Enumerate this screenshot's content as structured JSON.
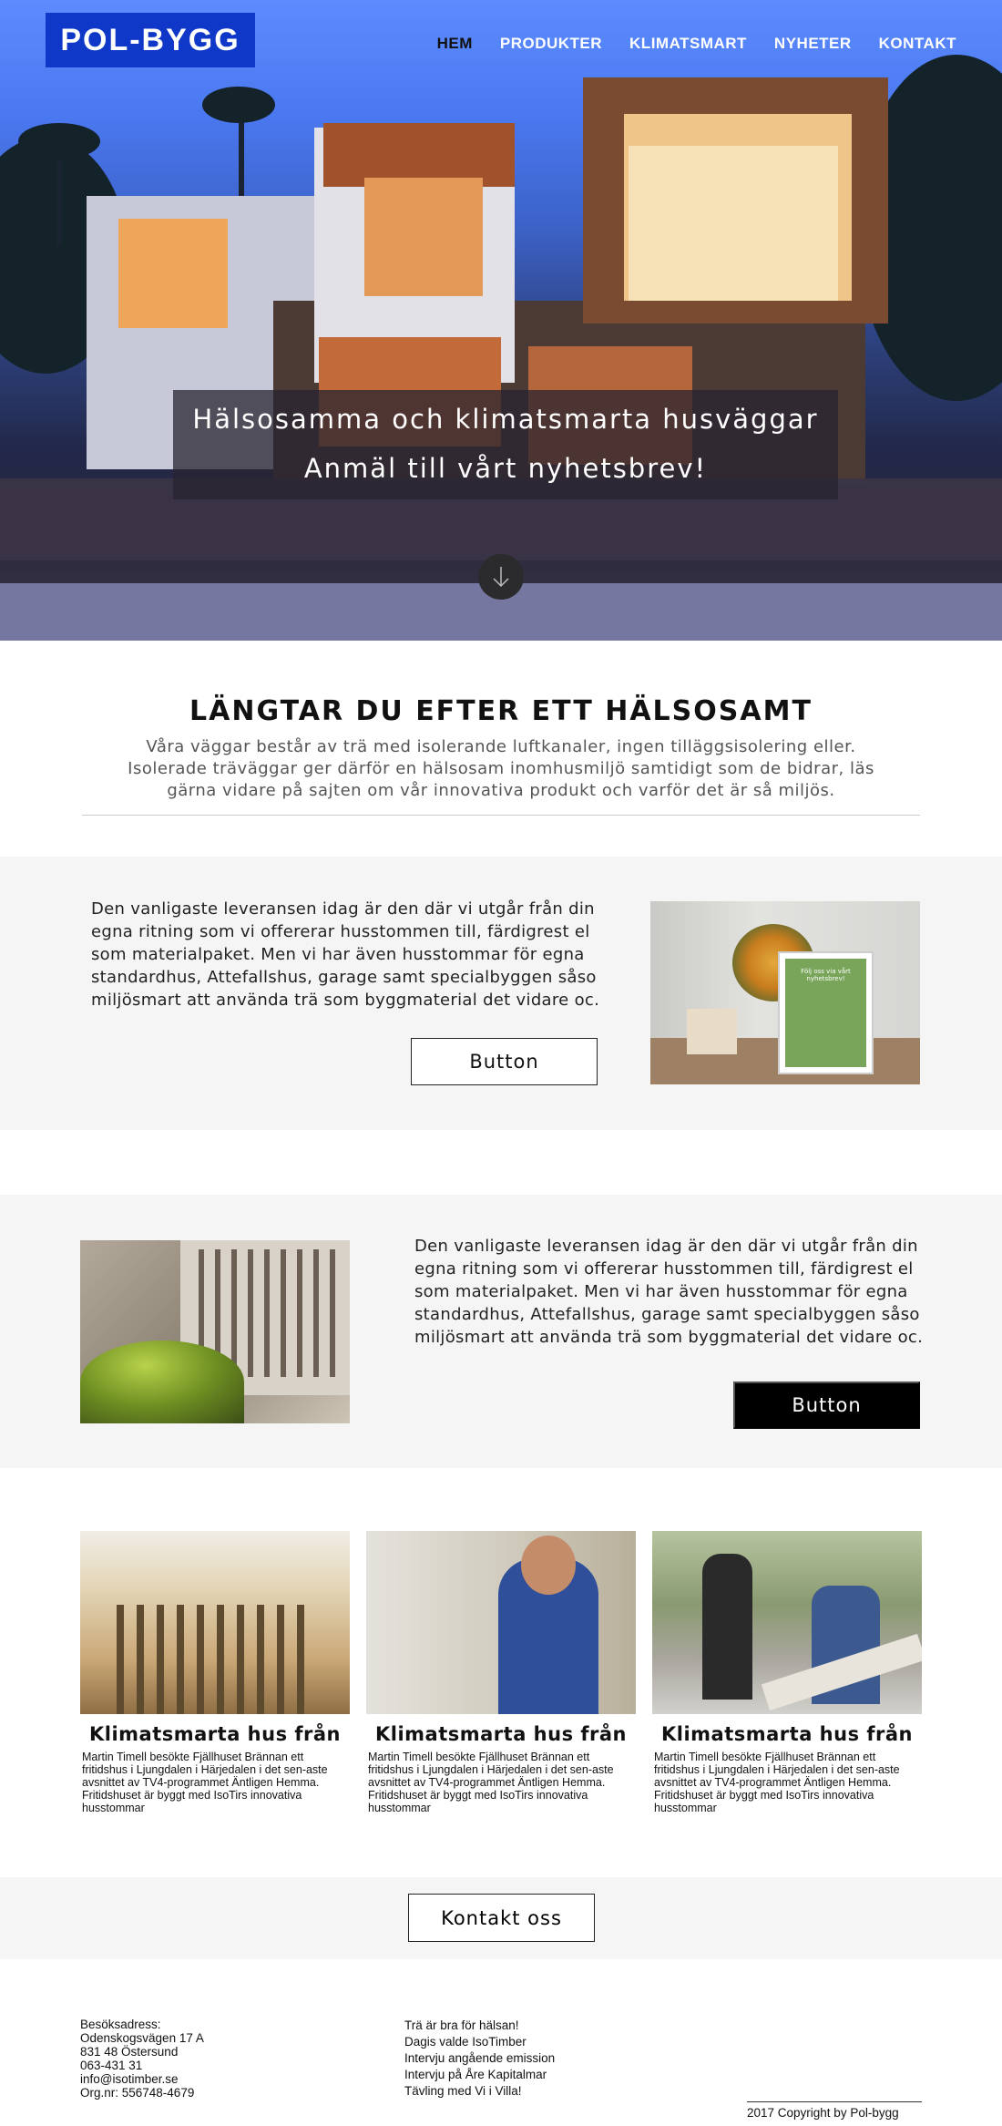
{
  "brand": {
    "logo": "POL-BYGG",
    "accent": "#1038c8"
  },
  "nav": [
    {
      "label": "HEM",
      "active": true
    },
    {
      "label": "PRODUKTER",
      "active": false
    },
    {
      "label": "KLIMATSMART",
      "active": false
    },
    {
      "label": "NYHETER",
      "active": false
    },
    {
      "label": "KONTAKT",
      "active": false
    }
  ],
  "hero": {
    "line1": "Hälsosamma och klimatsmarta husväggar",
    "line2": "Anmäl till vårt nyhetsbrev!",
    "scroll_icon": "arrow-down-icon"
  },
  "intro": {
    "title": "LÄNGTAR DU EFTER ETT HÄLSOSAMT",
    "text": "Våra väggar består av trä med isolerande luftkanaler, ingen tilläggsisolering eller. Isolerade träväggar ger därför en hälsosam inomhusmiljö samtidigt som de bidrar, läs gärna vidare på sajten om vår innovativa produkt och varför det är så miljös."
  },
  "feature1": {
    "text": "Den vanligaste leveransen idag är den där vi utgår från din egna ritning som vi offererar husstommen till, färdigrest el som materialpaket. Men vi har även husstommar för egna standardhus, Attefallshus, garage samt specialbyggen såso miljösmart att använda trä som byggmaterial det vidare oc.",
    "button": "Button",
    "sign_text": "Följ oss via vårt nyhetsbrev!"
  },
  "feature2": {
    "text": "Den vanligaste leveransen idag är den där vi utgår från din egna ritning som vi offererar husstommen till, färdigrest el som materialpaket. Men vi har även husstommar för egna standardhus, Attefallshus, garage samt specialbyggen såso miljösmart att använda trä som byggmaterial det vidare oc.",
    "button": "Button"
  },
  "cards": [
    {
      "title": "Klimatsmarta hus från",
      "desc": "Martin Timell besökte Fjällhuset Brännan ett fritidshus i Ljungdalen i Härjedalen i det sen-aste avsnittet av TV4-programmet Äntligen Hemma. Fritidshuset är byggt med IsoTirs innovativa husstommar"
    },
    {
      "title": "Klimatsmarta hus från",
      "desc": "Martin Timell besökte Fjällhuset Brännan ett fritidshus i Ljungdalen i Härjedalen i det sen-aste avsnittet av TV4-programmet Äntligen Hemma. Fritidshuset är byggt med IsoTirs innovativa husstommar"
    },
    {
      "title": "Klimatsmarta hus från",
      "desc": "Martin Timell besökte Fjällhuset Brännan ett fritidshus i Ljungdalen i Härjedalen i det sen-aste avsnittet av TV4-programmet Äntligen Hemma. Fritidshuset är byggt med IsoTirs innovativa husstommar"
    }
  ],
  "contact": {
    "button": "Kontakt oss"
  },
  "footer": {
    "address": [
      "Besöksadress:",
      "Odenskogsvägen 17 A",
      "831 48 Östersund",
      "063-431 31",
      "info@isotimber.se",
      "Org.nr: 556748-4679"
    ],
    "links": [
      "Trä är bra för hälsan!",
      "Dagis valde IsoTimber",
      "Intervju angående emission",
      "Intervju på Åre Kapitalmar",
      "Tävling med Vi i Villa!"
    ],
    "copyright": "2017 Copyright by Pol-bygg"
  }
}
